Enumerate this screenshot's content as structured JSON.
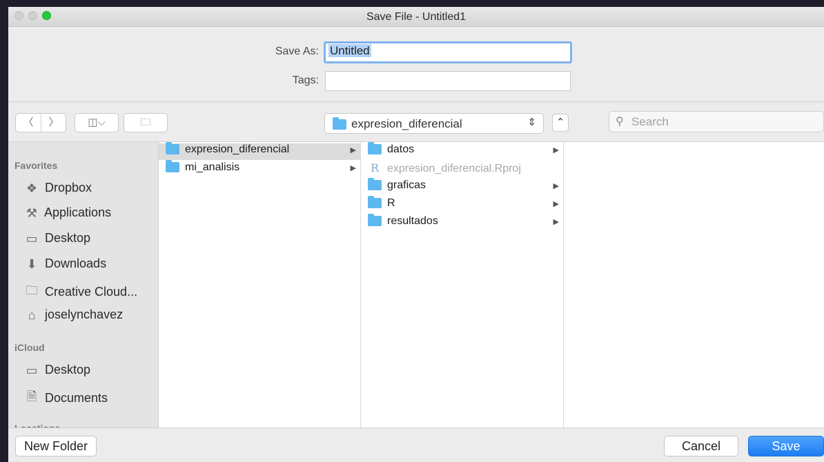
{
  "window": {
    "title": "Save File - Untitled1"
  },
  "form": {
    "save_as_label": "Save As:",
    "save_as_value": "Untitled",
    "tags_label": "Tags:",
    "tags_value": ""
  },
  "toolbar": {
    "location": "expresion_diferencial",
    "search_placeholder": "Search"
  },
  "sidebar": {
    "sections": [
      {
        "title": "Favorites",
        "items": [
          {
            "label": "Dropbox",
            "icon": "dropbox-icon"
          },
          {
            "label": "Applications",
            "icon": "applications-icon"
          },
          {
            "label": "Desktop",
            "icon": "desktop-icon"
          },
          {
            "label": "Downloads",
            "icon": "downloads-icon"
          },
          {
            "label": "Creative Cloud...",
            "icon": "folder-icon"
          },
          {
            "label": "joselynchavez",
            "icon": "home-icon"
          }
        ]
      },
      {
        "title": "iCloud",
        "items": [
          {
            "label": "Desktop",
            "icon": "desktop-icon"
          },
          {
            "label": "Documents",
            "icon": "documents-icon"
          }
        ]
      },
      {
        "title": "Locations",
        "items": []
      }
    ]
  },
  "columns": {
    "col1": [
      {
        "name": "expresion_diferencial",
        "type": "folder",
        "selected": true
      },
      {
        "name": "mi_analisis",
        "type": "folder",
        "selected": false
      }
    ],
    "col2": [
      {
        "name": "datos",
        "type": "folder"
      },
      {
        "name": "expresion_diferencial.Rproj",
        "type": "file"
      },
      {
        "name": "graficas",
        "type": "folder"
      },
      {
        "name": "R",
        "type": "folder"
      },
      {
        "name": "resultados",
        "type": "folder"
      }
    ]
  },
  "buttons": {
    "new_folder": "New Folder",
    "cancel": "Cancel",
    "save": "Save"
  }
}
